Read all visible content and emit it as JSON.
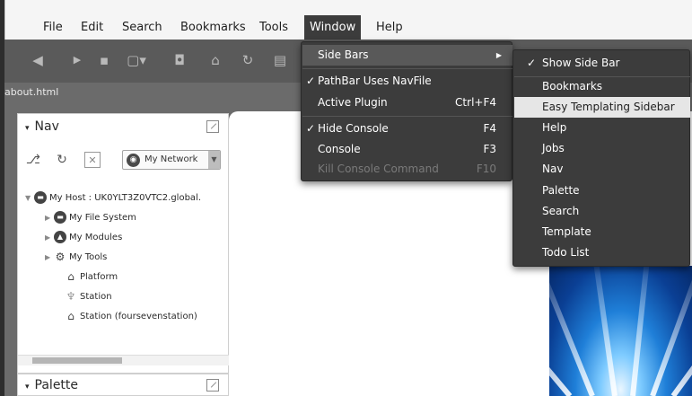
{
  "menubar": {
    "items": [
      "File",
      "Edit",
      "Search",
      "Bookmarks",
      "Tools",
      "Window",
      "Help"
    ],
    "active": "Window"
  },
  "toolbar": {
    "icons": [
      "back-icon",
      "forward-icon",
      "folder-icon",
      "view-menu-icon",
      "camera-icon",
      "home-icon",
      "refresh-icon",
      "document-icon"
    ]
  },
  "pathbar": {
    "text": "about.html"
  },
  "nav_panel": {
    "title": "Nav",
    "network_select": "My Network",
    "tree": [
      {
        "label": "My Host : UK0YLT3Z0VTC2.global.",
        "icon": "host-icon",
        "expanded": true
      },
      {
        "label": "My File System",
        "icon": "file-system-icon",
        "expanded": false
      },
      {
        "label": "My Modules",
        "icon": "modules-icon",
        "expanded": false
      },
      {
        "label": "My Tools",
        "icon": "tools-icon",
        "expanded": false
      },
      {
        "label": "Platform",
        "icon": "platform-icon"
      },
      {
        "label": "Station",
        "icon": "station-icon"
      },
      {
        "label": "Station (foursevenstation)",
        "icon": "station-icon"
      }
    ]
  },
  "palette_panel": {
    "title": "Palette"
  },
  "window_menu": {
    "items": [
      {
        "label": "Side Bars",
        "submenu": true,
        "highlight": true
      },
      {
        "label": "PathBar Uses NavFile",
        "checked": true
      },
      {
        "label": "Active Plugin",
        "shortcut": "Ctrl+F4"
      },
      {
        "label": "Hide Console",
        "checked": true,
        "shortcut": "F4"
      },
      {
        "label": "Console",
        "shortcut": "F3"
      },
      {
        "label": "Kill Console Command",
        "shortcut": "F10",
        "disabled": true
      }
    ]
  },
  "sidebars_submenu": {
    "items": [
      {
        "label": "Show Side Bar",
        "checked": true
      },
      {
        "label": "Bookmarks"
      },
      {
        "label": "Easy Templating Sidebar",
        "highlight": true
      },
      {
        "label": "Help"
      },
      {
        "label": "Jobs"
      },
      {
        "label": "Nav"
      },
      {
        "label": "Palette"
      },
      {
        "label": "Search"
      },
      {
        "label": "Template"
      },
      {
        "label": "Todo List"
      }
    ],
    "check_glyph": "✓"
  },
  "colors": {
    "menu_bg": "#3c3c3c",
    "menu_highlight": "#595959",
    "submenu_highlight": "#e6e6e6",
    "toolbar_bg": "#5a5a5a"
  }
}
